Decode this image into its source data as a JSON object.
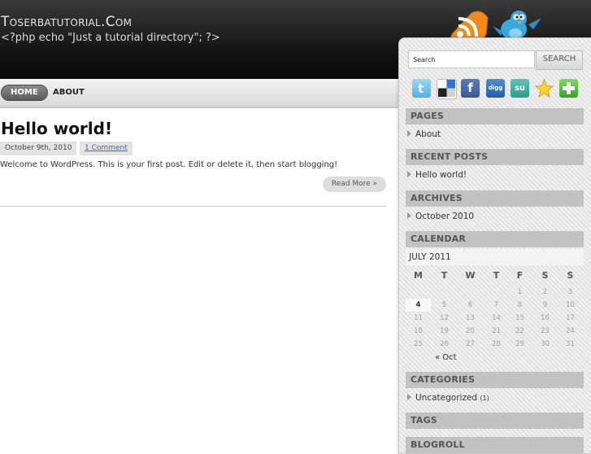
{
  "header": {
    "site_title": "Toserbatutorial.Com",
    "site_description": "<?php echo \"Just a tutorial directory\"; ?>"
  },
  "nav": {
    "home": "HOME",
    "about": "ABOUT"
  },
  "post": {
    "title": "Hello world!",
    "date": "October 9th, 2010",
    "comments": "1 Comment",
    "body": "Welcome to WordPress. This is your first post. Edit or delete it, then start blogging!",
    "read_more": "Read More »"
  },
  "sidebar": {
    "search": {
      "value": "Search",
      "button": "SEARCH"
    },
    "social_icons": [
      "twitter-icon",
      "delicious-icon",
      "facebook-icon",
      "digg-icon",
      "stumbleupon-icon",
      "favorite-icon",
      "add-icon"
    ],
    "social_labels": {
      "facebook": "f",
      "digg": "digg",
      "stumbleupon": "su"
    },
    "pages": {
      "title": "PAGES",
      "items": [
        "About"
      ]
    },
    "recent_posts": {
      "title": "RECENT POSTS",
      "items": [
        "Hello world!"
      ]
    },
    "archives": {
      "title": "ARCHIVES",
      "items": [
        "October 2010"
      ]
    },
    "calendar": {
      "title": "CALENDAR",
      "caption": "JULY 2011",
      "weekdays": [
        "M",
        "T",
        "W",
        "T",
        "F",
        "S",
        "S"
      ],
      "rows": [
        [
          "",
          "",
          "",
          "",
          "1",
          "2",
          "3"
        ],
        [
          "4",
          "5",
          "6",
          "7",
          "8",
          "9",
          "10"
        ],
        [
          "11",
          "12",
          "13",
          "14",
          "15",
          "16",
          "17"
        ],
        [
          "18",
          "19",
          "20",
          "21",
          "22",
          "23",
          "24"
        ],
        [
          "25",
          "26",
          "27",
          "28",
          "29",
          "30",
          "31"
        ]
      ],
      "today": "4",
      "prev": "« Oct"
    },
    "categories": {
      "title": "CATEGORIES",
      "items": [
        {
          "name": "Uncategorized",
          "count": "(1)"
        }
      ]
    },
    "tags": {
      "title": "TAGS"
    },
    "blogroll": {
      "title": "BLOGROLL"
    }
  },
  "colors": {
    "header_bg": "#111111",
    "rss_orange": "#f08a1c",
    "twitter_blue": "#3aa7e0",
    "link_blue": "#3a6fb0",
    "widget_header": "#c2c2c2"
  }
}
